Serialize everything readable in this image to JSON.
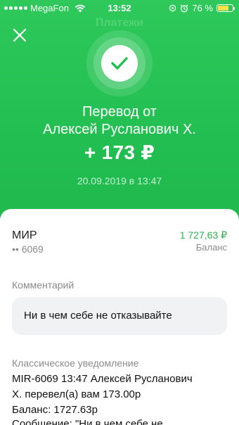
{
  "status_bar": {
    "carrier": "MegaFon",
    "time": "13:52",
    "battery_percent": "76 %",
    "battery_level": 0.76
  },
  "header": {
    "ghost_title": "Платежи",
    "title_line1": "Перевод от",
    "title_line2": "Алексей Русланович Х.",
    "amount": "+ 173 ₽",
    "datetime": "20.09.2019 в 13:47"
  },
  "account": {
    "name": "МИР",
    "number": "•• 6069",
    "balance_value": "1 727,63 ₽",
    "balance_label": "Баланс"
  },
  "comment": {
    "label": "Комментарий",
    "text": "Ни в чем себе не отказывайте"
  },
  "notification": {
    "label": "Классическое уведомление",
    "lines": [
      "MIR-6069 13:47 Алексей Русланович",
      "Х. перевел(а) вам 173.00р",
      "Баланс: 1727.63р",
      "Сообщение: \"Ни в чем себе не"
    ]
  },
  "colors": {
    "accent": "#23bf52",
    "balance": "#2bb44e"
  },
  "icons": [
    "close-icon",
    "checkmark-icon",
    "wifi-icon",
    "alarm-icon",
    "location-icon",
    "battery-icon"
  ]
}
